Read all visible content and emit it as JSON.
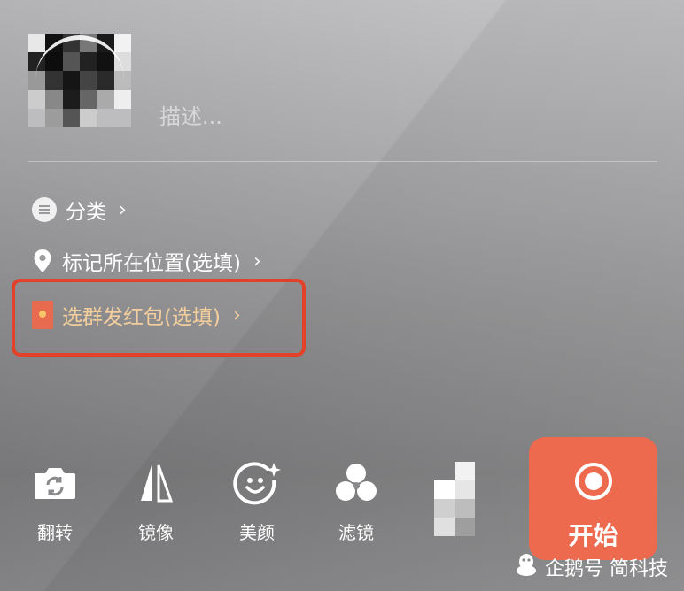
{
  "post": {
    "description_placeholder": "描述..."
  },
  "options": {
    "category_label": "分类",
    "location_label": "标记所在位置(选填)",
    "red_packet_label": "选群发红包(选填)",
    "chevron": "›"
  },
  "toolbar": {
    "flip_label": "翻转",
    "mirror_label": "镜像",
    "beauty_label": "美颜",
    "filter_label": "滤镜",
    "start_label": "开始"
  },
  "watermark": {
    "text": "企鹅号 简科技"
  },
  "colors": {
    "accent": "#ee6a4e",
    "highlight_border": "#e2412a",
    "red_packet_text": "#f4cf9d"
  },
  "icons": {
    "category": "list-circle-icon",
    "location": "map-pin-icon",
    "red_packet": "red-envelope-icon",
    "flip": "camera-flip-icon",
    "mirror": "mirror-icon",
    "beauty": "face-sparkle-icon",
    "filter": "filter-circles-icon",
    "start": "record-icon",
    "watermark": "penguin-icon"
  }
}
